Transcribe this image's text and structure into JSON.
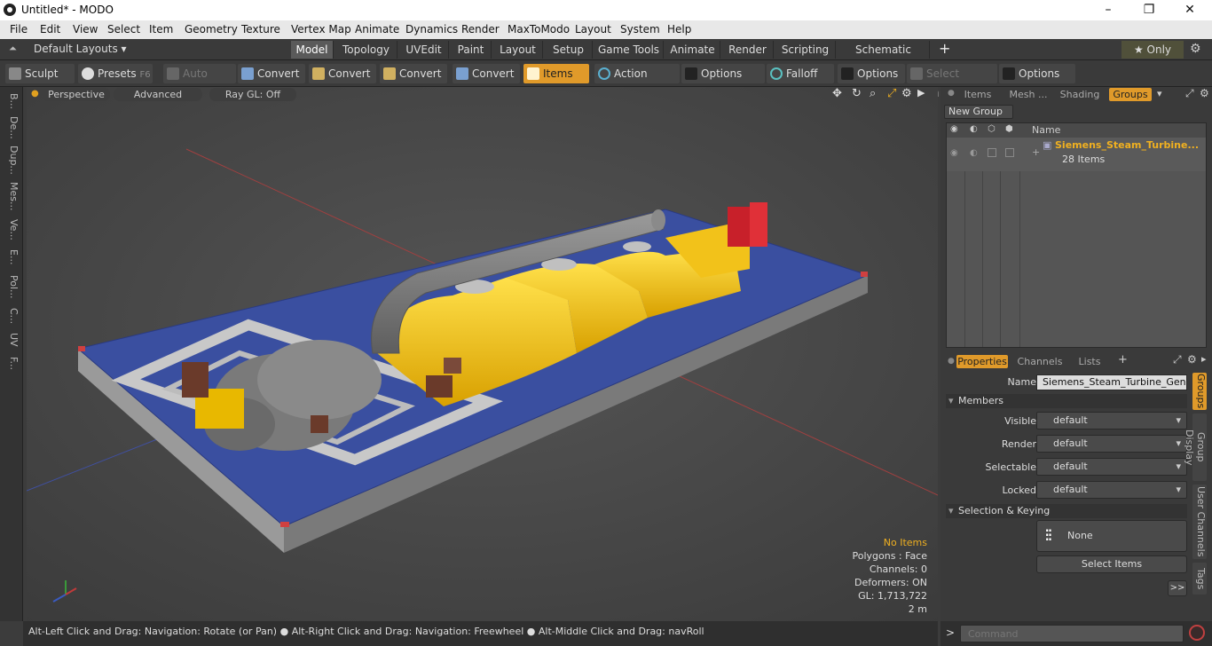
{
  "window": {
    "title": "Untitled* - MODO",
    "minimize_glyph": "–",
    "restore_glyph": "❐",
    "close_glyph": "✕"
  },
  "menu": [
    "File",
    "Edit",
    "View",
    "Select",
    "Item",
    "Geometry",
    "Texture",
    "Vertex Map",
    "Animate",
    "Dynamics",
    "Render",
    "MaxToModo",
    "Layout",
    "System",
    "Help"
  ],
  "layouts": {
    "label": "Default Layouts ▾",
    "tabs": [
      "Model",
      "Topology",
      "UVEdit",
      "Paint",
      "Layout",
      "Setup",
      "Game Tools",
      "Animate",
      "Render",
      "Scripting",
      "Schematic Fusion"
    ],
    "active": "Model",
    "add": "+",
    "only_label": "★ Only"
  },
  "toolbar": {
    "sculpt": "Sculpt",
    "presets": "Presets",
    "presets_key": "F6",
    "auto_select": "Auto Select",
    "convert1": "Convert",
    "convert2": "Convert",
    "convert3": "Convert",
    "convert4": "Convert",
    "items": "Items",
    "action_center": "Action Center",
    "options1": "Options",
    "falloff": "Falloff",
    "options2": "Options",
    "select_through": "Select Through",
    "options3": "Options"
  },
  "left_tabs": [
    "B...",
    "De...",
    "Dup...",
    "Mes...",
    "Ve...",
    "E...",
    "Pol...",
    "C...",
    "UV",
    "F..."
  ],
  "viewport": {
    "perspective": "Perspective",
    "advanced": "Advanced",
    "raygl": "Ray GL: Off",
    "stats": {
      "items": "No Items",
      "polygons": "Polygons : Face",
      "channels": "Channels: 0",
      "deformers": "Deformers: ON",
      "gl": "GL: 1,713,722",
      "scale": "2 m"
    }
  },
  "status": "Alt-Left Click and Drag: Navigation: Rotate (or Pan) ● Alt-Right Click and Drag: Navigation: Freewheel ● Alt-Middle Click and Drag: navRoll",
  "groups_panel": {
    "tabs": [
      "Items",
      "Mesh ...",
      "Shading",
      "Groups"
    ],
    "active": "Groups",
    "new_group": "New Group",
    "name_header": "Name",
    "group_name": "Siemens_Steam_Turbine...",
    "group_count": "28 Items"
  },
  "properties_panel": {
    "tabs": [
      "Properties",
      "Channels",
      "Lists"
    ],
    "add": "+",
    "name_label": "Name",
    "name_value": "Siemens_Steam_Turbine_Genera",
    "members_section": "Members",
    "visible_label": "Visible",
    "visible_value": "default",
    "render_label": "Render",
    "render_value": "default",
    "selectable_label": "Selectable",
    "selectable_value": "default",
    "locked_label": "Locked",
    "locked_value": "default",
    "selection_section": "Selection & Keying",
    "none_label": "None",
    "select_items": "Select Items",
    "more": ">>",
    "side_tabs": [
      "Groups",
      "Group Display",
      "User Channels",
      "Tags"
    ]
  },
  "command": {
    "prompt": ">",
    "placeholder": "Command"
  },
  "colors": {
    "accent": "#e09a2a",
    "platform_blue": "#3a4fa0",
    "turbine_yellow": "#f2c21a"
  }
}
